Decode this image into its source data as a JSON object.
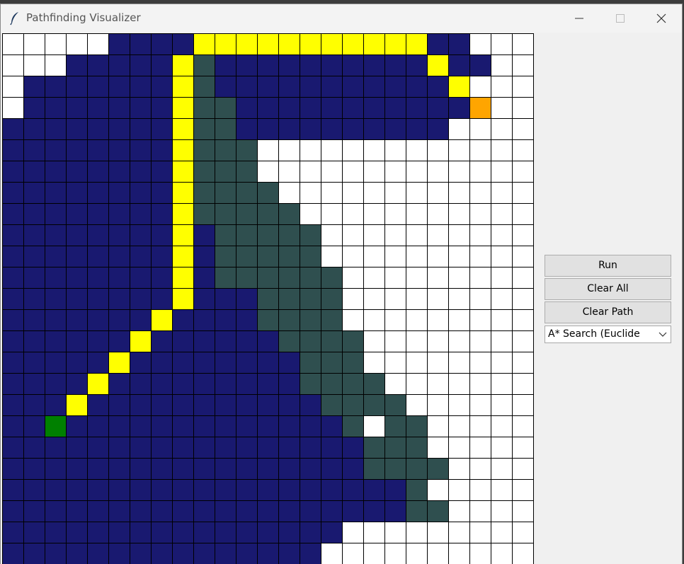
{
  "window": {
    "title": "Pathfinding Visualizer"
  },
  "controls": {
    "run_label": "Run",
    "clear_all_label": "Clear All",
    "clear_path_label": "Clear Path",
    "algorithm_selected": "A* Search (Euclide"
  },
  "icons": {
    "app": "feather-icon",
    "minimize": "minimize-icon",
    "maximize": "maximize-icon",
    "close": "close-icon",
    "dropdown": "chevron-down-icon"
  },
  "colors": {
    "W": "#ffffff",
    "B": "#191970",
    "Y": "#ffff00",
    "D": "#2f4f4f",
    "G": "#008000",
    "O": "#ffa500"
  },
  "legend": {
    "W": "empty",
    "B": "visited",
    "Y": "path",
    "D": "frontier",
    "G": "start",
    "O": "end"
  },
  "grid": [
    "WWWWWBBBBYYYYYYYYYYYBBWWW",
    "WWWBBBBBYDBBBBBBBBBBYBBWW",
    "WBBBBBBBYDBBBBBBBBBBBYWWW",
    "WBBBBBBBYDDBBBBBBBBBBBOWW",
    "BBBBBBBBYDDBBBBBBBBBBWWWW",
    "BBBBBBBBYDDDWWWWWWWWWWWWW",
    "BBBBBBBBYDDDWWWWWWWWWWWWW",
    "BBBBBBBBYDDDDWWWWWWWWWWWW",
    "BBBBBBBBYDDDDDWWWWWWWWWWW",
    "BBBBBBBBYBDDDDDWWWWWWWWWW",
    "BBBBBBBBYBDDDDDWWWWWWWWWW",
    "BBBBBBBBYBDDDDDDWWWWWWWWW",
    "BBBBBBBBYBBBDDDDWWWWWWWWW",
    "BBBBBBBYBBBBDDDDWWWWWWWWW",
    "BBBBBBYBBBBBBDDDDWWWWWWWW",
    "BBBBBYBBBBBBBBDDDWWWWWWWW",
    "BBBBYBBBBBBBBBDDDDWWWWWWW",
    "BBBYBBBBBBBBBBBDDDDWWWWWW",
    "BBGBBBBBBBBBBBBBDWDDWWWWW",
    "BBBBBBBBBBBBBBBBBDDDWWWWW",
    "BBBBBBBBBBBBBBBBBDDDDWWWW",
    "BBBBBBBBBBBBBBBBBBBDWWWWW",
    "BBBBBBBBBBBBBBBBBBBDDWWWW",
    "BBBBBBBBBBBBBBBBWWWWWWWWW",
    "BBBBBBBBBBBBBBBWWWWWWWWWW"
  ]
}
